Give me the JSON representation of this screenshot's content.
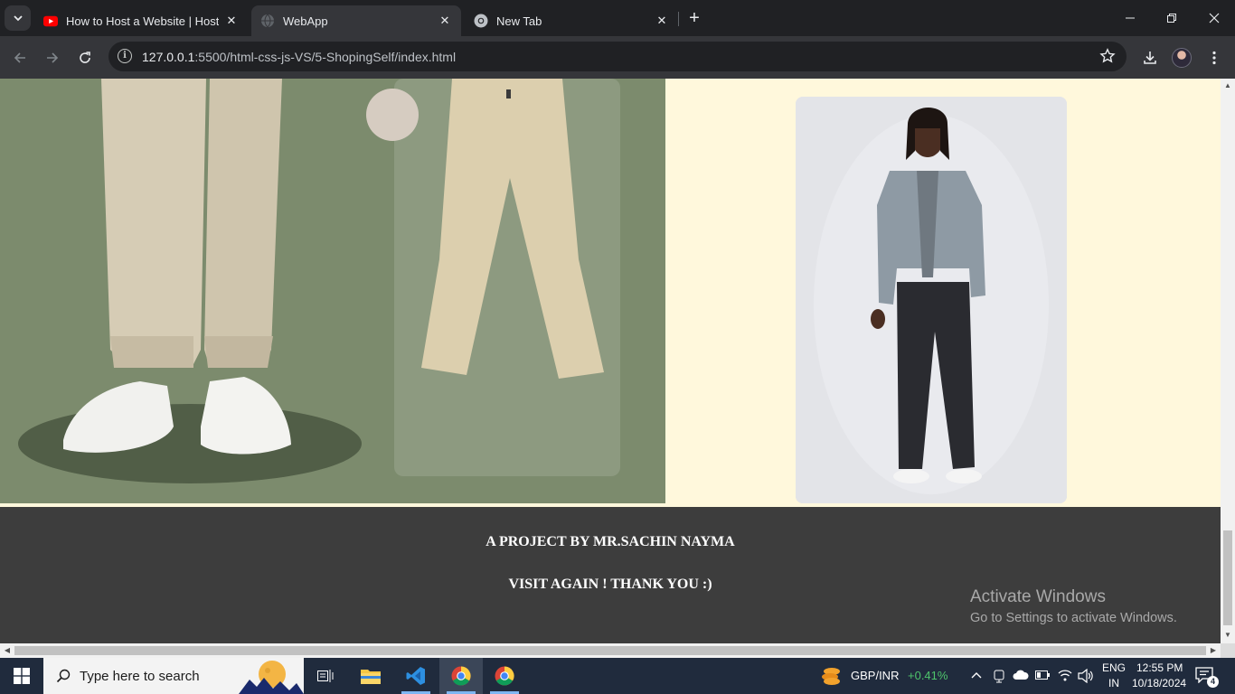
{
  "browser": {
    "tabs": [
      {
        "title": "How to Host a Website | Hosting",
        "icon": "youtube-icon",
        "active": false
      },
      {
        "title": "WebApp",
        "icon": "globe-icon",
        "active": true
      },
      {
        "title": "New Tab",
        "icon": "chrome-icon",
        "active": false
      }
    ],
    "new_tab_symbol": "+",
    "close_symbol": "✕",
    "url_host": "127.0.0.1",
    "url_rest": ":5500/html-css-js-VS/5-ShopingSelf/index.html"
  },
  "page": {
    "images": [
      {
        "name": "beige-chinos-product-image",
        "background": "#7b8a6c"
      },
      {
        "name": "man-grey-jacket-image",
        "background": "#e2e3e7"
      }
    ],
    "row_background": "#fff8dc",
    "footer": {
      "line1": "A PROJECT BY MR.SACHIN NAYMA",
      "line2": "VISIT AGAIN ! THANK YOU :)",
      "background": "#3d3d3d"
    }
  },
  "watermark": {
    "title": "Activate Windows",
    "subtitle": "Go to Settings to activate Windows."
  },
  "taskbar": {
    "search_placeholder": "Type here to search",
    "ticker": "GBP/INR",
    "ticker_change": "+0.41%",
    "lang_top": "ENG",
    "lang_bottom": "IN",
    "time": "12:55 PM",
    "date": "10/18/2024",
    "notification_count": "4",
    "accent_green": "#4ec46c"
  }
}
